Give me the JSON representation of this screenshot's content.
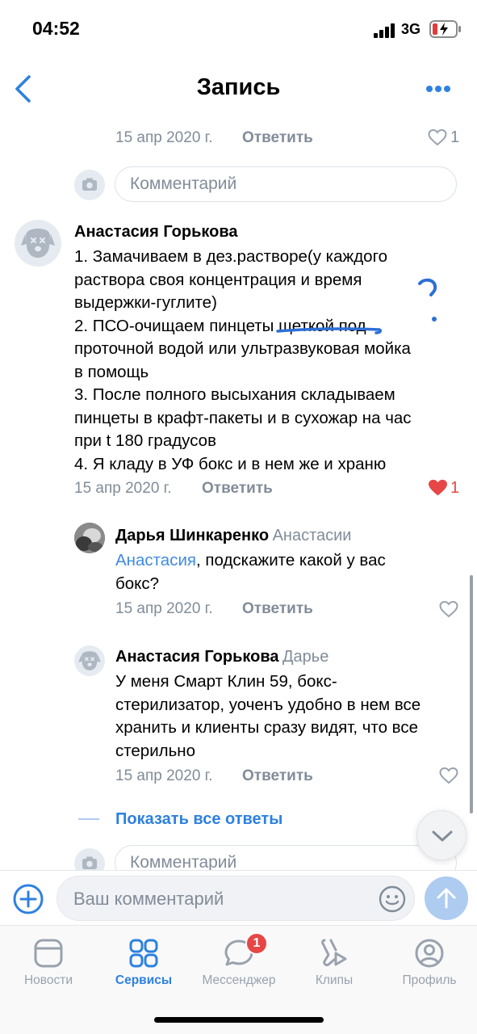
{
  "status_bar": {
    "time": "04:52",
    "network": "3G"
  },
  "header": {
    "title": "Запись"
  },
  "top_meta": {
    "date": "15 апр 2020 г.",
    "reply_label": "Ответить",
    "likes": "1"
  },
  "comment_input_1": {
    "placeholder": "Комментарий"
  },
  "comment_main": {
    "author": "Анастасия Горькова",
    "lines": [
      "1. Замачиваем в дез.растворе(у каждого",
      "раствора своя концентрация и время",
      "выдержки-гуглите)",
      "2. ПСО-очищаем пинцеты щеткой под",
      "проточной водой или ультразвуковая мойка",
      "в помощь",
      "3. После полного высыхания складываем",
      "пинцеты в крафт-пакеты и в сухожар на час",
      "при t 180 градусов",
      "4. Я кладу в УФ бокс и в нем же и храню"
    ],
    "date": "15 апр 2020 г.",
    "reply_label": "Ответить",
    "likes": "1"
  },
  "reply_1": {
    "author": "Дарья Шинкаренко",
    "reply_to": "Анастасии",
    "mention": "Анастасия",
    "text_after_mention": ", подскажите какой у вас",
    "line2": "бокс?",
    "date": "15 апр 2020 г.",
    "reply_label": "Ответить"
  },
  "reply_2": {
    "author": "Анастасия Горькова",
    "reply_to": "Дарье",
    "lines": [
      "У меня Смарт Клин 59, бокс-",
      "стерилизатор, уоченъ удобно в нем все",
      "хранить и клиенты сразу видят, что все",
      "стерильно"
    ],
    "date": "15 апр 2020 г.",
    "reply_label": "Ответить"
  },
  "show_all_replies": "Показать все ответы",
  "comment_input_2": {
    "placeholder": "Комментарий"
  },
  "bottom_input": {
    "placeholder": "Ваш комментарий"
  },
  "tabs": [
    {
      "label": "Новости",
      "icon": "news-icon"
    },
    {
      "label": "Сервисы",
      "icon": "services-icon",
      "active": true
    },
    {
      "label": "Мессенджер",
      "icon": "messenger-icon",
      "badge": "1"
    },
    {
      "label": "Клипы",
      "icon": "clips-icon"
    },
    {
      "label": "Профиль",
      "icon": "profile-icon"
    }
  ],
  "colors": {
    "accent": "#2d81e0",
    "like_active": "#e64646",
    "secondary_text": "#818c99",
    "annotation": "#2d6fd6"
  }
}
